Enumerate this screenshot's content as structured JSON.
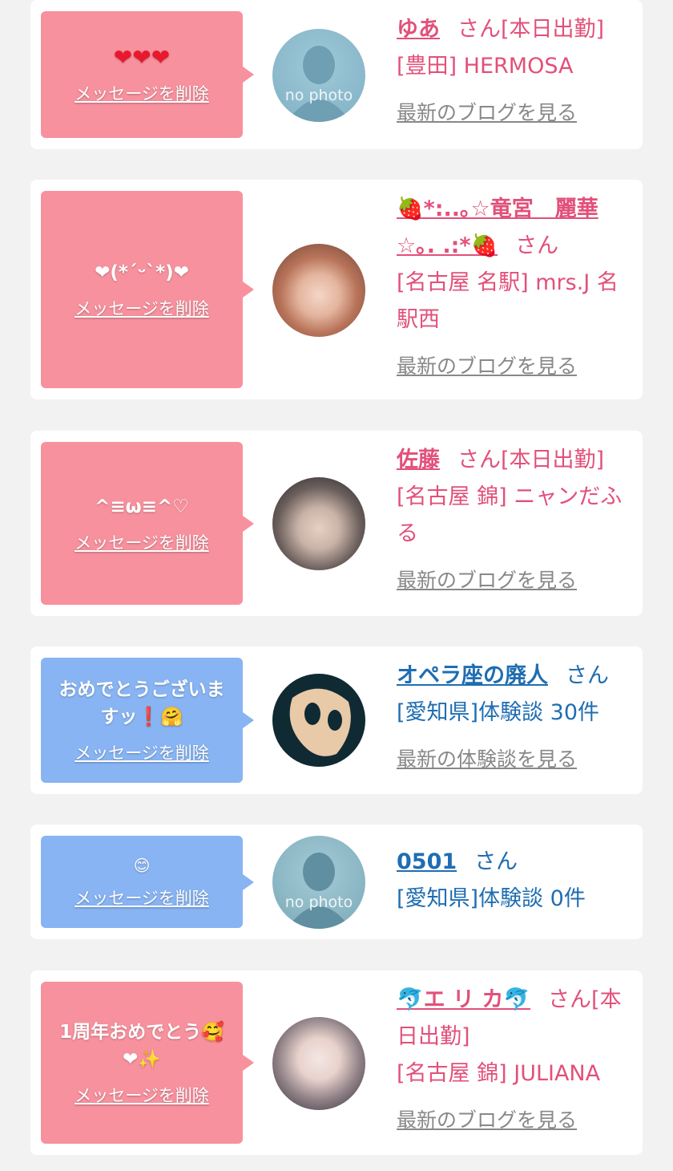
{
  "delete_label": "メッセージを削除",
  "honorific": "さん",
  "cards": [
    {
      "message": "❤❤❤",
      "name": "ゆあ",
      "status": "[本日出勤]",
      "shop": "[豊田] HERMOSA",
      "link": "最新のブログを見る",
      "avatar_label": "no photo"
    },
    {
      "message": "❤(*´ᵕ`*)❤",
      "name": "🍓*:..｡☆竜宮　麗華☆｡. .:*🍓",
      "status": "",
      "shop": "[名古屋 名駅] mrs.J 名駅西",
      "link": "最新のブログを見る"
    },
    {
      "message": "^≡ω≡^♡",
      "name": "佐藤",
      "status": "[本日出勤]",
      "shop": "[名古屋 錦] ニャンだふる",
      "link": "最新のブログを見る"
    },
    {
      "message": "おめでとうございますッ❗🤗",
      "name": "オペラ座の廃人",
      "status": "",
      "shop": "[愛知県]体験談 30件",
      "link": "最新の体験談を見る"
    },
    {
      "message": "😊",
      "name": "0501",
      "status": "",
      "shop": "[愛知県]体験談 0件",
      "link": "",
      "avatar_label": "no photo"
    },
    {
      "message": "1周年おめでとう🥰❤✨",
      "name": "🐬エ リ カ🐬",
      "status": "[本日出勤]",
      "shop": "[名古屋 錦] JULIANA",
      "link": "最新のブログを見る"
    }
  ],
  "colors": {
    "pink_bubble": "#f7919e",
    "blue_bubble": "#88b4f3",
    "pink_text": "#e2507a",
    "blue_text": "#1f6db2",
    "link_gray": "#888888"
  }
}
